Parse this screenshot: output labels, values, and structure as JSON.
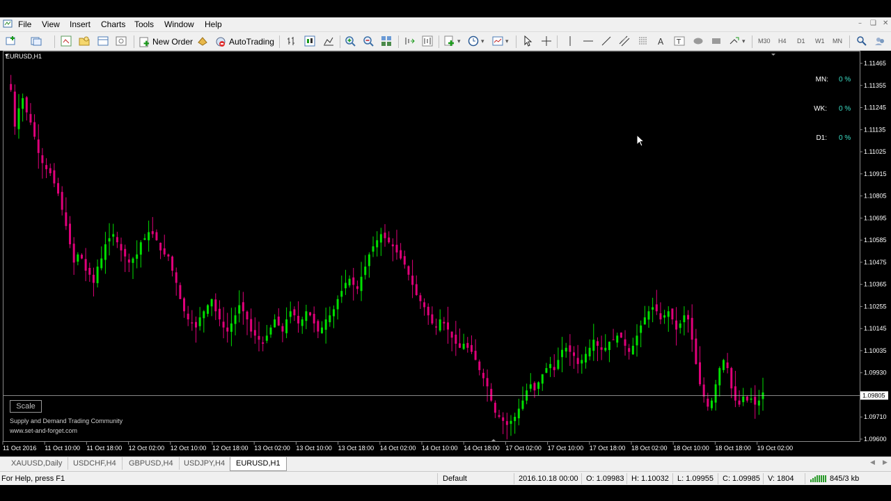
{
  "menu": {
    "items": [
      "File",
      "View",
      "Insert",
      "Charts",
      "Tools",
      "Window",
      "Help"
    ]
  },
  "toolbar": {
    "new_order_label": "New Order",
    "autotrading_label": "AutoTrading",
    "timeframes": [
      "M30",
      "H4",
      "D1",
      "W1",
      "MN"
    ]
  },
  "chart": {
    "title": "EURUSD,H1",
    "stats": [
      {
        "label": "MN:",
        "value": "0 %"
      },
      {
        "label": "WK:",
        "value": "0 %"
      },
      {
        "label": "D1:",
        "value": "0 %"
      }
    ],
    "scale_label": "Scale",
    "watermark_line1": "Supply and Demand Trading Community",
    "watermark_line2": "www.set-and-forget.com",
    "colors": {
      "bull": "#00e000",
      "bear": "#e0007a",
      "grid": "#8a8a8a",
      "text": "#ffffff",
      "bid_line": "#b4b4b4"
    }
  },
  "chart_data": {
    "type": "candlestick",
    "title": "EURUSD,H1",
    "y_ticks": [
      "1.11465",
      "1.11355",
      "1.11245",
      "1.11135",
      "1.11025",
      "1.10915",
      "1.10805",
      "1.10695",
      "1.10585",
      "1.10475",
      "1.10365",
      "1.10255",
      "1.10145",
      "1.10035",
      "1.09930",
      "1.09805",
      "1.09710",
      "1.09600"
    ],
    "current_price": "1.09805",
    "x_ticks": [
      "11 Oct 2016",
      "11 Oct 10:00",
      "11 Oct 18:00",
      "12 Oct 02:00",
      "12 Oct 10:00",
      "12 Oct 18:00",
      "13 Oct 02:00",
      "13 Oct 10:00",
      "13 Oct 18:00",
      "14 Oct 02:00",
      "14 Oct 10:00",
      "14 Oct 18:00",
      "17 Oct 02:00",
      "17 Oct 10:00",
      "17 Oct 18:00",
      "18 Oct 02:00",
      "18 Oct 10:00",
      "18 Oct 18:00",
      "19 Oct 02:00"
    ],
    "ylim": [
      1.0958,
      1.115
    ],
    "path": [
      1.1134,
      1.1131,
      1.1113,
      1.1122,
      1.1127,
      1.112,
      1.1115,
      1.1108,
      1.11,
      1.1095,
      1.1092,
      1.109,
      1.1085,
      1.108,
      1.1072,
      1.1064,
      1.1055,
      1.1046,
      1.105,
      1.1048,
      1.1042,
      1.104,
      1.1036,
      1.1044,
      1.1048,
      1.1055,
      1.1058,
      1.106,
      1.1056,
      1.1052,
      1.1049,
      1.1046,
      1.1048,
      1.105,
      1.1056,
      1.1058,
      1.1061,
      1.106,
      1.1057,
      1.1052,
      1.105,
      1.1049,
      1.1042,
      1.1036,
      1.1028,
      1.1022,
      1.1018,
      1.1016,
      1.1014,
      1.1019,
      1.1022,
      1.1025,
      1.1028,
      1.1022,
      1.1018,
      1.1014,
      1.1012,
      1.1016,
      1.102,
      1.1025,
      1.1022,
      1.1018,
      1.1012,
      1.101,
      1.1008,
      1.1006,
      1.101,
      1.1014,
      1.1018,
      1.1015,
      1.1012,
      1.1018,
      1.1022,
      1.102,
      1.1016,
      1.1018,
      1.1022,
      1.102,
      1.1016,
      1.1012,
      1.1014,
      1.1018,
      1.102,
      1.1023,
      1.1028,
      1.1032,
      1.1036,
      1.1038,
      1.1035,
      1.1033,
      1.1039,
      1.1044,
      1.105,
      1.1054,
      1.1057,
      1.106,
      1.1058,
      1.1056,
      1.1054,
      1.1051,
      1.1048,
      1.1045,
      1.104,
      1.1035,
      1.103,
      1.1027,
      1.1024,
      1.102,
      1.1016,
      1.1014,
      1.1018,
      1.1016,
      1.1013,
      1.1009,
      1.1006,
      1.1004,
      1.1006,
      1.1004,
      1.1002,
      1.0998,
      1.0993,
      1.0989,
      1.0985,
      1.0978,
      1.0972,
      1.097,
      1.0968,
      1.0966,
      1.0968,
      1.097,
      1.0974,
      1.0978,
      1.0983,
      1.0986,
      1.0983,
      1.0987,
      1.0991,
      1.0994,
      1.0996,
      1.0993,
      1.0998,
      1.1003,
      1.1004,
      1.1002,
      1.1,
      1.0996,
      1.0998,
      1.1001,
      1.1004,
      1.1008,
      1.1005,
      1.1003,
      1.1004,
      1.1007,
      1.1008,
      1.101,
      1.1009,
      1.1005,
      1.1002,
      1.1005,
      1.101,
      1.1015,
      1.1019,
      1.1022,
      1.1024,
      1.1022,
      1.1018,
      1.102,
      1.1022,
      1.1018,
      1.1013,
      1.1016,
      1.102,
      1.1018,
      1.1008,
      1.0996,
      1.0986,
      1.098,
      1.0975,
      1.0978,
      1.0986,
      1.0994,
      1.0998,
      1.0994,
      1.0984,
      1.0978,
      1.0976,
      1.098,
      1.0978,
      1.0979,
      1.0976,
      1.0978,
      1.0982
    ]
  },
  "tabs": [
    "XAUUSD,Daily",
    "USDCHF,H4",
    "GBPUSD,H4",
    "USDJPY,H4",
    "EURUSD,H1"
  ],
  "active_tab": "EURUSD,H1",
  "status": {
    "help": "For Help, press F1",
    "profile": "Default",
    "datetime": "2016.10.18 00:00",
    "open": "O: 1.09983",
    "high": "H: 1.10032",
    "low": "L: 1.09955",
    "close": "C: 1.09985",
    "volume": "V: 1804",
    "traffic": "845/3 kb"
  }
}
